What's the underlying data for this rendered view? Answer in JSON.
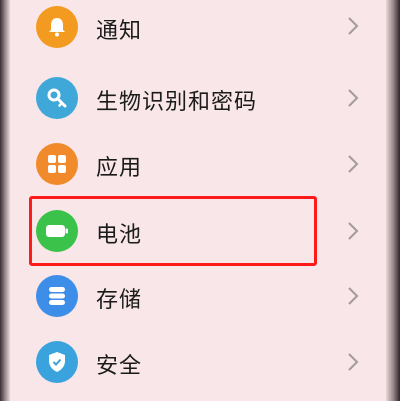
{
  "settings_list": {
    "items": [
      {
        "label": "通知",
        "icon": "bell-icon",
        "icon_color": "#f39a20"
      },
      {
        "label": "生物识别和密码",
        "icon": "key-icon",
        "icon_color": "#3fa8d8"
      },
      {
        "label": "应用",
        "icon": "apps-grid-icon",
        "icon_color": "#f08a2a"
      },
      {
        "label": "电池",
        "icon": "battery-icon",
        "icon_color": "#3bc24a"
      },
      {
        "label": "存储",
        "icon": "storage-icon",
        "icon_color": "#3d8ee8"
      },
      {
        "label": "安全",
        "icon": "shield-icon",
        "icon_color": "#3aa3dd"
      }
    ]
  },
  "highlight_color": "#ff1a1a",
  "background_color": "#f8e6e8"
}
